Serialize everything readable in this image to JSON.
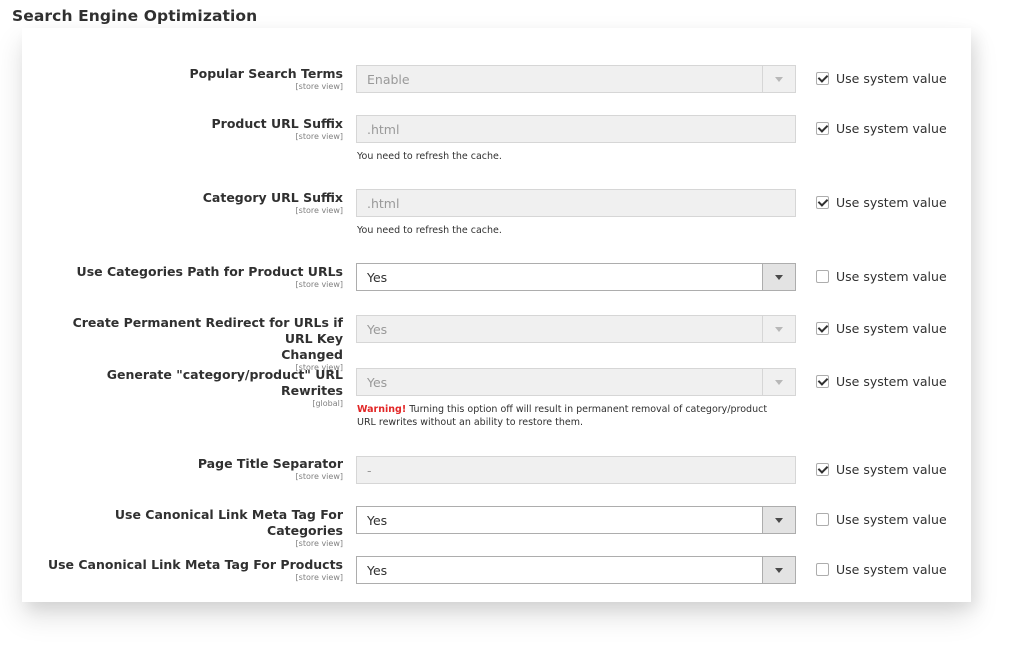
{
  "section": {
    "title": "Search Engine Optimization"
  },
  "rows": [
    {
      "label": "Popular Search Terms",
      "scope": "[store view]",
      "value": "Enable",
      "use_system": true
    },
    {
      "label": "Product URL Suffix",
      "scope": "[store view]",
      "value": ".html",
      "note": "You need to refresh the cache.",
      "use_system": true
    },
    {
      "label": "Category URL Suffix",
      "scope": "[store view]",
      "value": ".html",
      "note": "You need to refresh the cache.",
      "use_system": true
    },
    {
      "label": "Use Categories Path for Product URLs",
      "scope": "[store view]",
      "value": "Yes",
      "use_system": false
    },
    {
      "label_line1": "Create Permanent Redirect for URLs if URL Key",
      "label_line2": "Changed",
      "scope": "[store view]",
      "value": "Yes",
      "use_system": true
    },
    {
      "label": "Generate \"category/product\" URL Rewrites",
      "scope": "[global]",
      "value": "Yes",
      "warning_label": "Warning!",
      "warning_line1": "Turning this option off will result in permanent removal of category/product",
      "warning_line2": "URL rewrites without an ability to restore them.",
      "use_system": true
    },
    {
      "label": "Page Title Separator",
      "scope": "[store view]",
      "value": "-",
      "use_system": true
    },
    {
      "label": "Use Canonical Link Meta Tag For Categories",
      "scope": "[store view]",
      "value": "Yes",
      "use_system": false
    },
    {
      "label": "Use Canonical Link Meta Tag For Products",
      "scope": "[store view]",
      "value": "Yes",
      "use_system": false
    }
  ],
  "system_value_label": "Use system value",
  "icons": {
    "dropdown": "chevron-down-icon",
    "checked": "checkmark-icon"
  }
}
